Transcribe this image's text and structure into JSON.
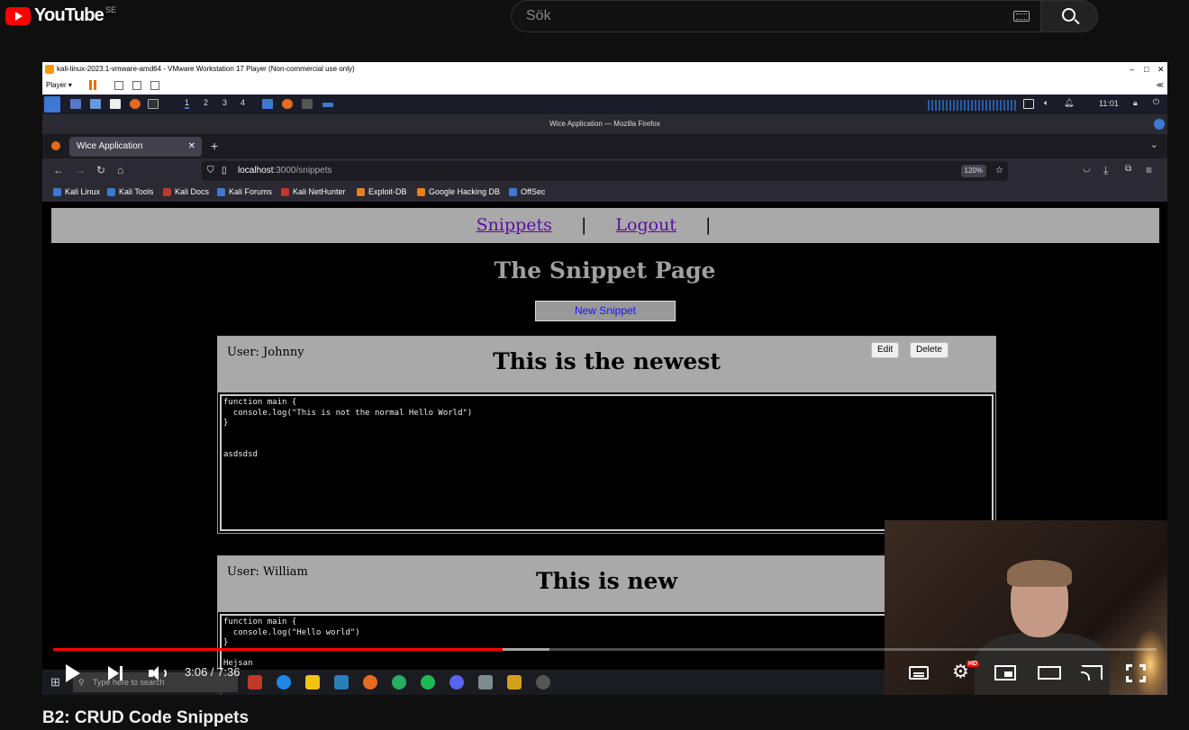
{
  "youtube": {
    "logo_text": "YouTube",
    "region": "SE",
    "search_placeholder": "Sök"
  },
  "vmware": {
    "title": "kali-linux-2023.1-vmware-amd64 - VMware Workstation 17 Player (Non-commercial use only)",
    "player_menu": "Player ▾",
    "collapse": "≪"
  },
  "kali": {
    "workspaces": [
      "1",
      "2",
      "3",
      "4"
    ],
    "clock": "11:01"
  },
  "firefox": {
    "window_title": "Wice Application — Mozilla Firefox",
    "tab_title": "Wice Application",
    "url_host": "localhost",
    "url_path": ":3000/snippets",
    "zoom": "120%",
    "bookmarks": [
      {
        "label": "Kali Linux",
        "color": "#3b79d4"
      },
      {
        "label": "Kali Tools",
        "color": "#3b79d4"
      },
      {
        "label": "Kali Docs",
        "color": "#c0392b"
      },
      {
        "label": "Kali Forums",
        "color": "#3b79d4"
      },
      {
        "label": "Kali NetHunter",
        "color": "#c0392b"
      },
      {
        "label": "Exploit-DB",
        "color": "#e67e22"
      },
      {
        "label": "Google Hacking DB",
        "color": "#e67e22"
      },
      {
        "label": "OffSec",
        "color": "#3b79d4"
      }
    ]
  },
  "webpage": {
    "nav_snippets": "Snippets",
    "nav_logout": "Logout",
    "nav_separator": "|",
    "heading": "The Snippet Page",
    "new_snippet_button": "New Snippet",
    "snippets": [
      {
        "user": "User: Johnny",
        "title": "This is the newest",
        "edit_label": "Edit",
        "delete_label": "Delete",
        "code": "function main {\n  console.log(\"This is not the normal Hello World\")\n}\n\n\nasdsdsd"
      },
      {
        "user": "User: William",
        "title": "This is new",
        "code": "function main {\n  console.log(\"Hello world\")\n}\n\nHejsan"
      }
    ]
  },
  "windows_taskbar": {
    "search_placeholder": "Type here to search"
  },
  "video": {
    "current_time": "3:06",
    "duration": "7:36",
    "time_display": "3:06 / 7:36",
    "played_fraction": 0.407,
    "buffered_fraction": 0.45,
    "hd_badge": "HD",
    "title": "B2: CRUD Code Snippets",
    "colors": {
      "progress": "#ff0000",
      "logo": "#ff0000"
    }
  }
}
